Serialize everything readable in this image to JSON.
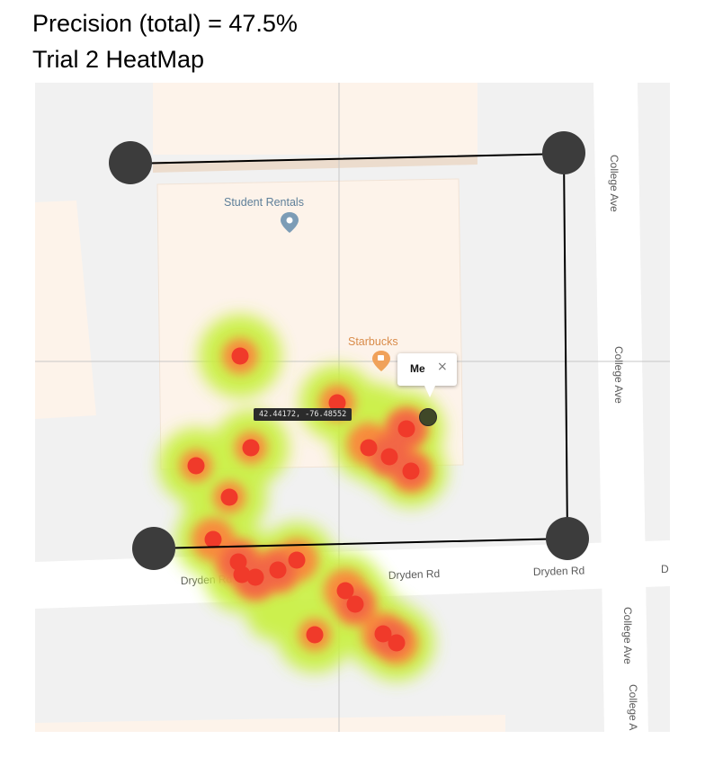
{
  "title": {
    "line1": "Precision (total) = 47.5%",
    "line2": "Trial 2 HeatMap"
  },
  "map": {
    "pois": [
      {
        "id": "student-rentals",
        "label": "Student Rentals",
        "icon": "map-pin-icon",
        "color": "#7c9cb6"
      },
      {
        "id": "starbucks",
        "label": "Starbucks",
        "icon": "coffee-cup-icon",
        "color": "#f0a15a"
      }
    ],
    "street_labels": {
      "college_ave": "College Ave",
      "college_ave_truncated": "College A",
      "dryden_rd": "Dryden Rd",
      "dryden_rd_truncated": "D"
    },
    "coordinate_readout": "42.44172, -76.48552",
    "user_marker": {
      "label": "Me",
      "close_symbol": "×"
    },
    "colors": {
      "heat_core": "#f03a2a",
      "heat_mid": "#ff7a3a",
      "heat_halo": "#c8f03c",
      "anchor": "#3c3c3c",
      "boundary": "#000000"
    }
  }
}
